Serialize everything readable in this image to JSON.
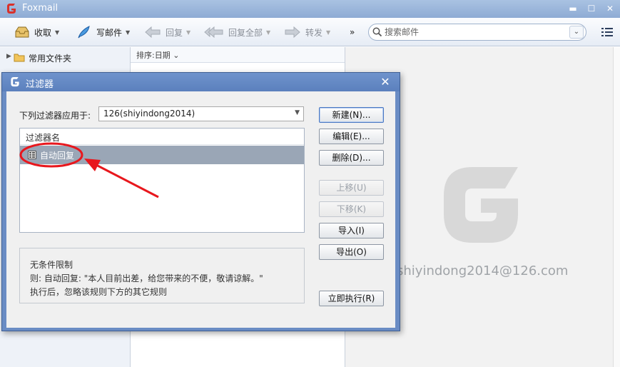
{
  "app": {
    "title": "Foxmail"
  },
  "toolbar": {
    "receive": "收取",
    "compose": "写邮件",
    "reply": "回复",
    "reply_all": "回复全部",
    "forward": "转发",
    "more": "»",
    "search_placeholder": "搜索邮件"
  },
  "sidebar": {
    "folder_label": "常用文件夹"
  },
  "maillist": {
    "sort_label": "排序:日期 ⌄"
  },
  "reading_pane": {
    "account_email": "shiyindong2014@126.com"
  },
  "dialog": {
    "title": "过滤器",
    "apply_label": "下列过滤器应用于:",
    "account_select_value": "126(shiyindong2014)",
    "list_header": "过滤器名",
    "filters": [
      {
        "name": "自动回复"
      }
    ],
    "info": {
      "line1": "无条件限制",
      "line2": "则:  自动回复: \"本人目前出差，给您带来的不便，敬请谅解。\"",
      "line3": "执行后，忽略该规则下方的其它规则"
    },
    "buttons": {
      "new": "新建(N)...",
      "edit": "编辑(E)...",
      "delete": "删除(D)...",
      "move_up": "上移(U)",
      "move_down": "下移(K)",
      "import": "导入(I)",
      "export": "导出(O)",
      "run_now": "立即执行(R)"
    }
  },
  "colors": {
    "dialog_frame": "#6a8cc4",
    "selection": "#9aa6b6",
    "annotation_red": "#e8171d",
    "brand_red": "#d9302a"
  }
}
